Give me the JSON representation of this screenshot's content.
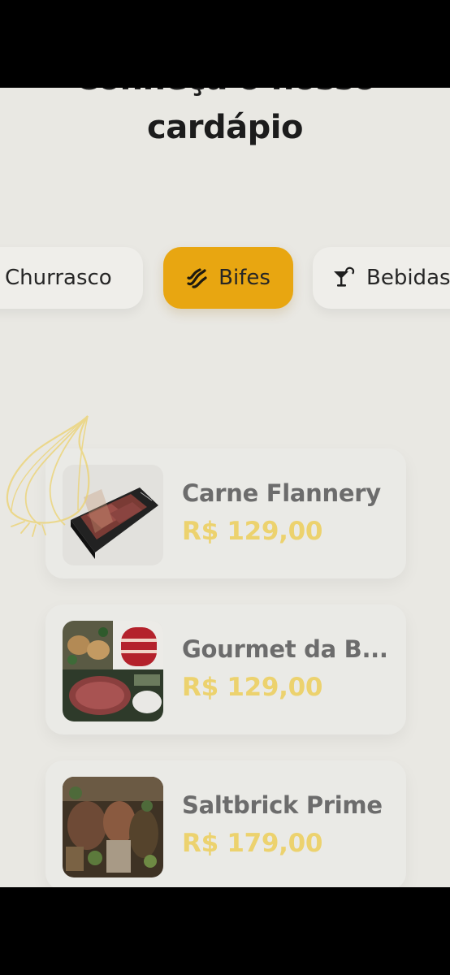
{
  "header": {
    "title_line1": "Conheça o nosso",
    "title_line2": "cardápio"
  },
  "categories": [
    {
      "label": "Churrasco",
      "icon": "none",
      "active": false
    },
    {
      "label": "Bifes",
      "icon": "steak-icon",
      "active": true
    },
    {
      "label": "Bebidas",
      "icon": "cocktail-icon",
      "active": false
    }
  ],
  "products": [
    {
      "name": "Carne Flannery",
      "price": "R$ 129,00",
      "image": "boxed-meat-photo"
    },
    {
      "name": "Gourmet da B...",
      "price": "R$ 129,00",
      "image": "steak-collage-photo"
    },
    {
      "name": "Saltbrick Prime",
      "price": "R$ 179,00",
      "image": "grilled-platter-photo"
    }
  ],
  "colors": {
    "background": "#e9e8e3",
    "accent": "#e8a611",
    "price": "#ecd26e",
    "text": "#1c1c1c"
  }
}
